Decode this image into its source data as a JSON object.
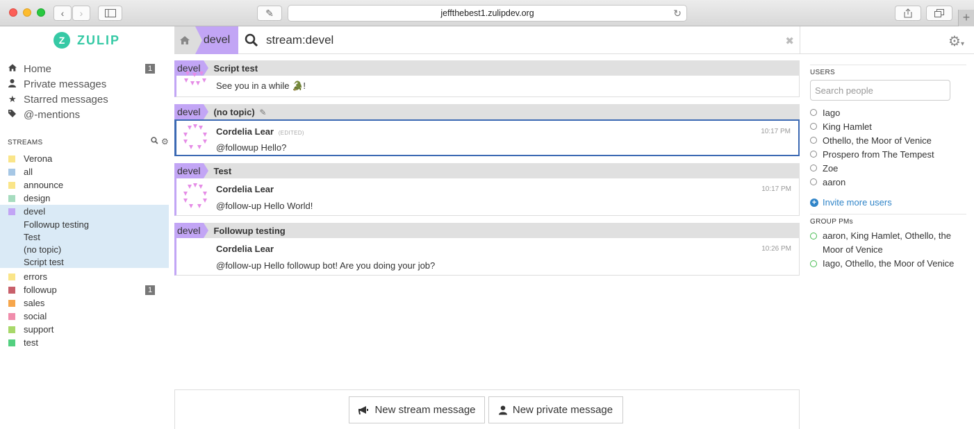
{
  "browser": {
    "url": "jeffthebest1.zulipdev.org"
  },
  "brand": {
    "logo_letter": "Z",
    "name": "ZULIP"
  },
  "navbar": {
    "stream": "devel",
    "search": "stream:devel"
  },
  "left_nav": [
    {
      "label": "Home",
      "icon": "home-icon",
      "count": "1"
    },
    {
      "label": "Private messages",
      "icon": "user-icon",
      "count": ""
    },
    {
      "label": "Starred messages",
      "icon": "star-icon",
      "count": ""
    },
    {
      "label": "@-mentions",
      "icon": "tag-icon",
      "count": ""
    }
  ],
  "streams_header": "STREAMS",
  "streams": [
    {
      "name": "Verona",
      "color": "#fae589"
    },
    {
      "name": "all",
      "color": "#a6c7e5"
    },
    {
      "name": "announce",
      "color": "#fae589"
    },
    {
      "name": "design",
      "color": "#a6dcbf"
    }
  ],
  "devel_stream": {
    "name": "devel",
    "color": "#c2a5f5",
    "topics": [
      "Followup testing",
      "Test",
      "(no topic)",
      "Script test"
    ]
  },
  "streams_after": [
    {
      "name": "errors",
      "color": "#fae589",
      "count": ""
    },
    {
      "name": "followup",
      "color": "#c8606b",
      "count": "1"
    },
    {
      "name": "sales",
      "color": "#f6a64c",
      "count": ""
    },
    {
      "name": "social",
      "color": "#f08dac",
      "count": ""
    },
    {
      "name": "support",
      "color": "#a8d86a",
      "count": ""
    },
    {
      "name": "test",
      "color": "#53d080",
      "count": ""
    }
  ],
  "recipients": [
    {
      "stream": "devel",
      "topic": "Script test",
      "message": {
        "sender": "",
        "time": "",
        "content": "See you in a while",
        "emoji": "🐊!"
      }
    },
    {
      "stream": "devel",
      "topic": "(no topic)",
      "message": {
        "sender": "Cordelia Lear",
        "edited": "(EDITED)",
        "time": "10:17 PM",
        "content": "@followup Hello?"
      }
    },
    {
      "stream": "devel",
      "topic": "Test",
      "message": {
        "sender": "Cordelia Lear",
        "time": "10:17 PM",
        "content": "@follow-up Hello World!"
      }
    },
    {
      "stream": "devel",
      "topic": "Followup testing",
      "message": {
        "sender": "Cordelia Lear",
        "time": "10:26 PM",
        "content": "@follow-up Hello followup bot! Are you doing your job?"
      }
    }
  ],
  "compose": {
    "new_stream": "New stream message",
    "new_private": "New private message"
  },
  "right": {
    "users_title": "USERS",
    "search_placeholder": "Search people",
    "users": [
      "Iago",
      "King Hamlet",
      "Othello, the Moor of Venice",
      "Prospero from The Tempest",
      "Zoe",
      "aaron"
    ],
    "invite": "Invite more users",
    "group_title": "GROUP PMs",
    "group_pms": [
      "aaron, King Hamlet, Othello, the Moor of Venice",
      "Iago, Othello, the Moor of Venice"
    ]
  },
  "colors": {
    "devel": "#c2a5f5",
    "selected_border": "#3b69b3",
    "brand": "#36c9a5",
    "link": "#2f84c8"
  }
}
